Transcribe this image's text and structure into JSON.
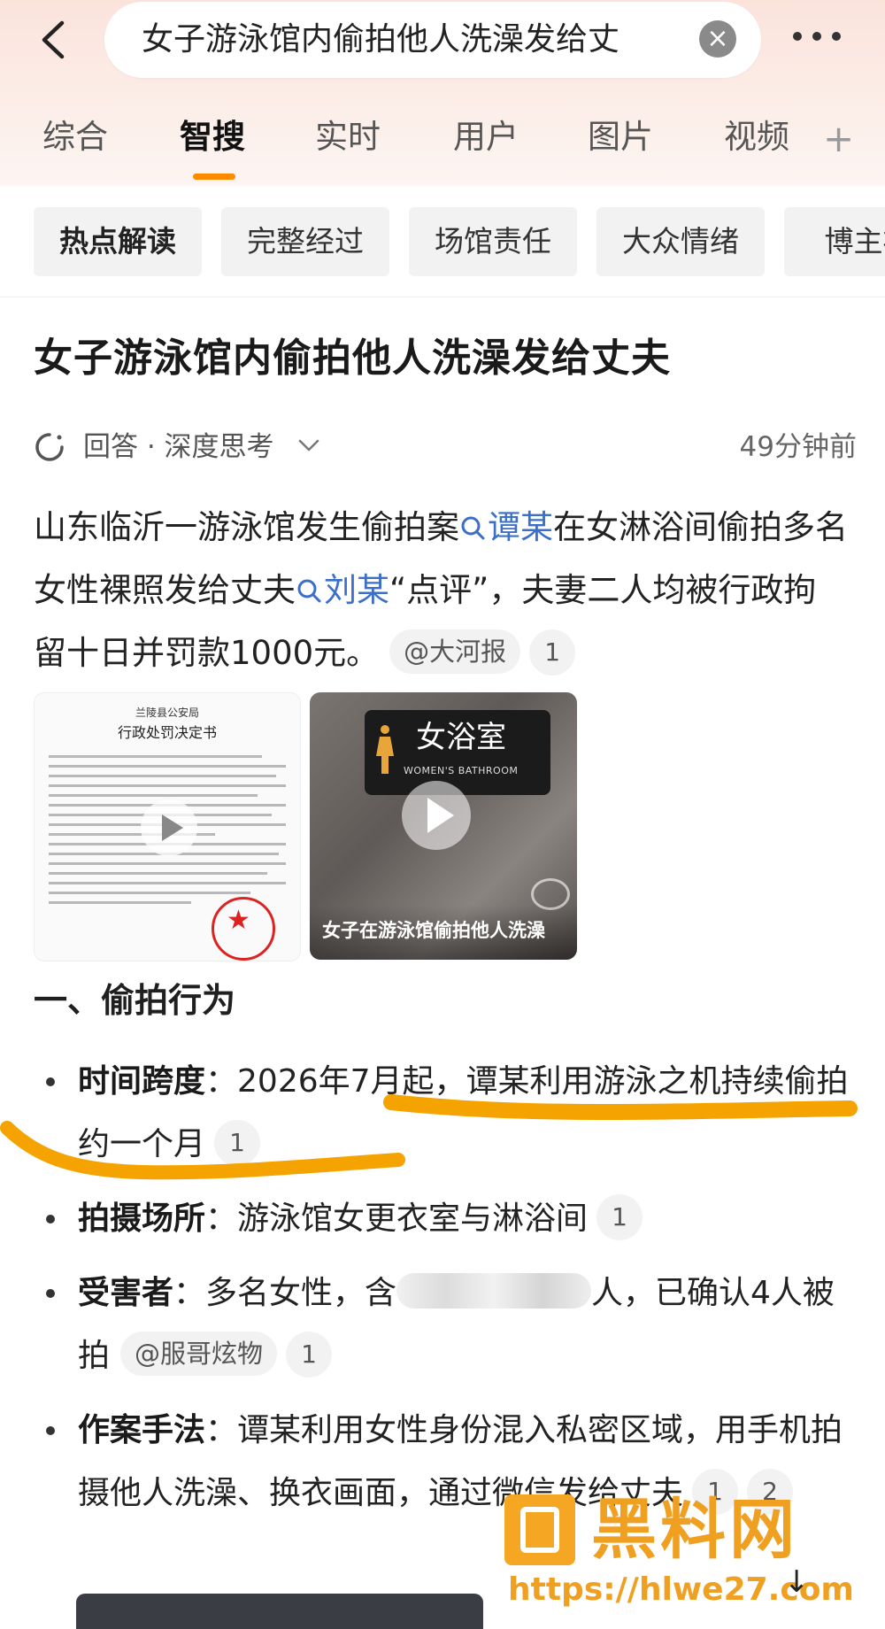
{
  "search": {
    "query": "女子游泳馆内偷拍他人洗澡发给丈"
  },
  "tabs": [
    "综合",
    "智搜",
    "实时",
    "用户",
    "图片",
    "视频"
  ],
  "active_tab": "智搜",
  "chips": [
    "热点解读",
    "完整经过",
    "场馆责任",
    "大众情绪",
    "博主补"
  ],
  "article": {
    "title": "女子游泳馆内偷拍他人洗澡发给丈夫",
    "meta_label": "回答 · 深度思考",
    "meta_time": "49分钟前",
    "para": {
      "t1": "山东临沂一游泳馆发生偷拍案",
      "link1": "谭某",
      "t2": "在女淋浴间偷拍多名女性裸照发给丈夫",
      "link2": "刘某",
      "t3": "“点评”，夫妻二人均被行政拘留十日并罚款1000元。",
      "source": "@大河报",
      "source_num": "1"
    },
    "media": {
      "doc_header_small": "兰陵县公安局",
      "doc_header": "行政处罚决定书",
      "sign_cn": "女浴室",
      "sign_en": "WOMEN'S BATHROOM",
      "video_caption": "女子在游泳馆偷拍他人洗澡"
    },
    "section_title": "一、偷拍行为",
    "bullets": [
      {
        "label": "时间跨度",
        "text": "：2026年7月起，谭某利用游泳之机持续偷拍约一个月",
        "refs": [
          "1"
        ]
      },
      {
        "label": "拍摄场所",
        "text": "：游泳馆女更衣室与淋浴间",
        "refs": [
          "1"
        ]
      },
      {
        "label": "受害者",
        "text_a": "：多名女性，含",
        "text_b": "人，已确认4人被拍",
        "source": "@服哥炫物",
        "refs": [
          "1"
        ]
      },
      {
        "label": "作案手法",
        "text": "：谭某利用女性身份混入私密区域，用手机拍摄他人洗澡、换衣画面，通过微信发给丈夫",
        "refs": [
          "1",
          "2"
        ]
      }
    ]
  },
  "watermark": {
    "title": "黑料网",
    "url": "https://hlwe27.com"
  },
  "colors": {
    "accent": "#ff8a00",
    "link": "#3b6fc8",
    "highlight_stroke": "#f5a300",
    "watermark": "#f0a020"
  }
}
